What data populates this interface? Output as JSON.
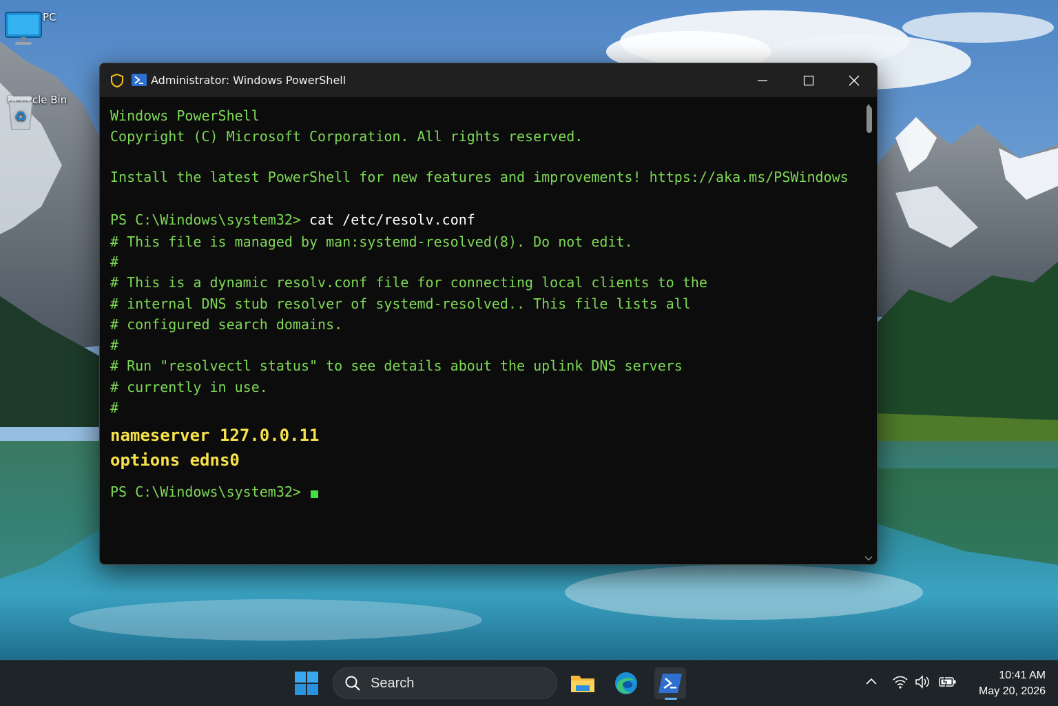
{
  "desktop": {
    "icons": [
      {
        "label": "This PC",
        "icon": "monitor-icon"
      },
      {
        "label": "Recycle Bin",
        "icon": "recycle-bin-icon"
      }
    ]
  },
  "window": {
    "title": "Administrator: Windows PowerShell",
    "icons": {
      "shield": "shield-icon",
      "app": "powershell-icon"
    },
    "controls": {
      "minimize": "minimize-icon",
      "maximize": "maximize-icon",
      "close": "close-icon"
    }
  },
  "terminal": {
    "lines": [
      "Windows PowerShell",
      "Copyright (C) Microsoft Corporation. All rights reserved.",
      "Install the latest PowerShell for new features and improvements! https://aka.ms/PSWindows",
      "# This file is managed by man:systemd-resolved(8). Do not edit.",
      "#",
      "# This is a dynamic resolv.conf file for connecting local clients to the",
      "# internal DNS stub resolver of systemd-resolved.. This file lists all",
      "# configured search domains.",
      "#",
      "# Run \"resolvectl status\" to see details about the uplink DNS servers",
      "# currently in use.",
      "#"
    ],
    "prompt": "PS C:\\Windows\\system32>",
    "command": "cat /etc/resolv.conf",
    "highlighted": [
      "nameserver 127.0.0.11",
      "options edns0"
    ],
    "colors": {
      "text": "#7ed957",
      "command": "#ffffff",
      "highlight": "#f7e24a",
      "cursor": "#3fe03f",
      "background": "#0c0c0c"
    }
  },
  "taskbar": {
    "search_label": "Search",
    "apps": [
      "windows-start-icon",
      "file-explorer-icon",
      "edge-icon",
      "powershell-icon"
    ],
    "active_app": "powershell-icon",
    "tray": [
      "chevron-up-icon",
      "wifi-icon",
      "volume-icon",
      "battery-icon"
    ],
    "clock": {
      "time": "10:41 AM",
      "date": "May 20, 2026"
    }
  }
}
